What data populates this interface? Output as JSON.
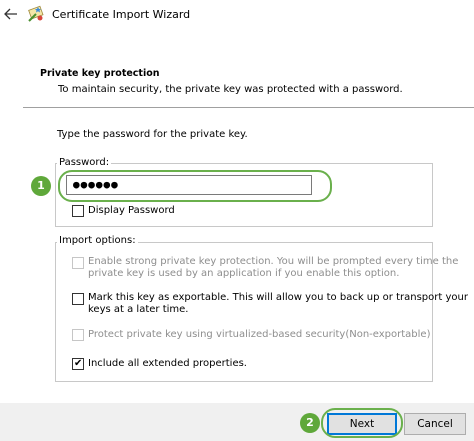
{
  "window": {
    "title": "Certificate Import Wizard"
  },
  "header": {
    "heading": "Private key protection",
    "subheading": "To maintain security, the private key was protected with a password."
  },
  "main": {
    "instruction": "Type the password for the private key.",
    "password": {
      "label": "Password:",
      "value": "●●●●●●",
      "display_label": "Display Password",
      "display_checked": false
    },
    "import_options": {
      "label": "Import options:",
      "options": [
        {
          "text_line1": "Enable strong private key protection. You will be prompted every time the",
          "text_line2": "private key is used by an application if you enable this option.",
          "checked": false,
          "enabled": false
        },
        {
          "text_line1": "Mark this key as exportable. This will allow you to back up or transport your",
          "text_line2": "keys at a later time.",
          "checked": false,
          "enabled": true
        },
        {
          "text_line1": "Protect private key using virtualized-based security(Non-exportable)",
          "text_line2": "",
          "checked": false,
          "enabled": false
        },
        {
          "text_line1": "Include all extended properties.",
          "text_line2": "",
          "checked": true,
          "enabled": true
        }
      ]
    }
  },
  "annotations": {
    "badge1": "1",
    "badge2": "2",
    "color": "#5fa83a"
  },
  "footer": {
    "next_label": "Next",
    "cancel_label": "Cancel"
  },
  "icons": {
    "back": "back-arrow-icon",
    "wizard": "certificate-wizard-icon",
    "check": "✔"
  }
}
